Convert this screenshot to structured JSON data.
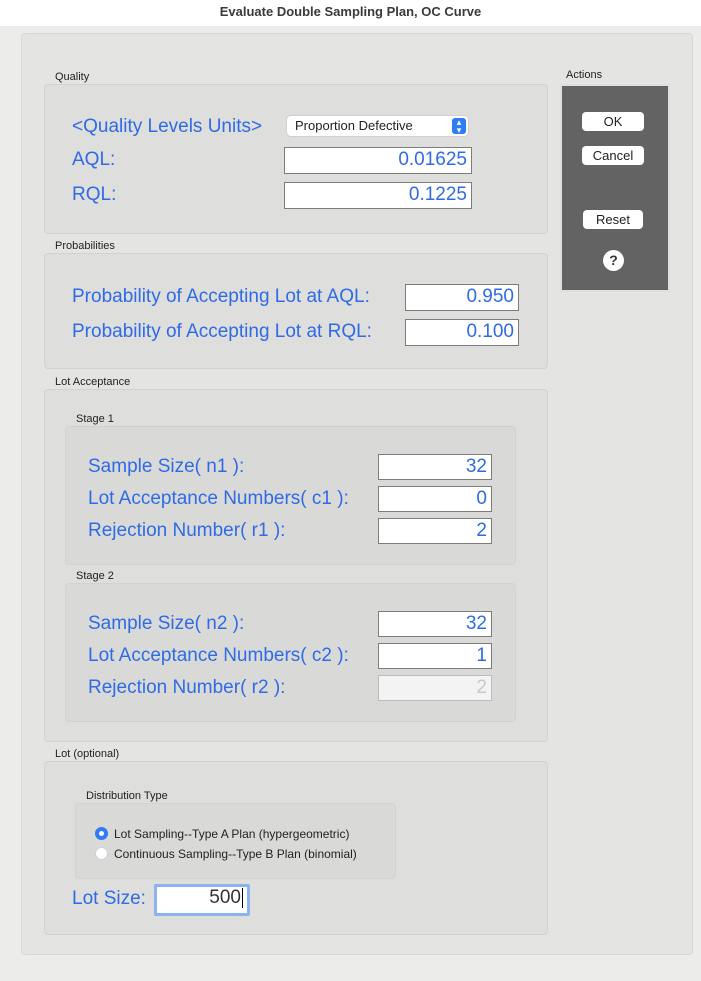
{
  "window": {
    "title": "Evaluate Double Sampling Plan, OC Curve"
  },
  "quality": {
    "group_label": "Quality",
    "units_label": "<Quality Levels Units>",
    "units_selected": "Proportion Defective",
    "aql_label": "AQL:",
    "aql_value": "0.01625",
    "rql_label": "RQL:",
    "rql_value": "0.1225"
  },
  "probabilities": {
    "group_label": "Probabilities",
    "aql_label": "Probability of Accepting Lot at AQL:",
    "aql_value": "0.950",
    "rql_label": "Probability of Accepting Lot at RQL:",
    "rql_value": "0.100"
  },
  "lot_acceptance": {
    "group_label": "Lot Acceptance",
    "stage1": {
      "label": "Stage 1",
      "n_label": "Sample Size( n1 ):",
      "n_value": "32",
      "c_label": "Lot Acceptance Numbers( c1 ):",
      "c_value": "0",
      "r_label": "Rejection Number( r1 ):",
      "r_value": "2"
    },
    "stage2": {
      "label": "Stage 2",
      "n_label": "Sample Size( n2 ):",
      "n_value": "32",
      "c_label": "Lot Acceptance Numbers( c2 ):",
      "c_value": "1",
      "r_label": "Rejection Number( r2 ):",
      "r_value": "2"
    }
  },
  "lot": {
    "group_label": "Lot (optional)",
    "distribution_label": "Distribution Type",
    "options": [
      {
        "label": "Lot Sampling--Type A Plan (hypergeometric)",
        "selected": true
      },
      {
        "label": "Continuous Sampling--Type B Plan (binomial)",
        "selected": false
      }
    ],
    "lot_size_label": "Lot Size:",
    "lot_size_value": "500"
  },
  "actions": {
    "group_label": "Actions",
    "ok": "OK",
    "cancel": "Cancel",
    "reset": "Reset",
    "help": "?"
  }
}
